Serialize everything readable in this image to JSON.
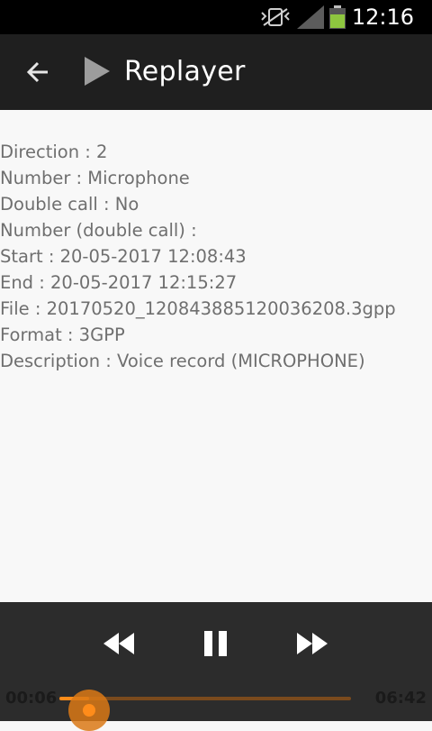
{
  "status_bar": {
    "time": "12:16",
    "icons": [
      "vibrate-icon",
      "signal-icon",
      "battery-icon"
    ],
    "battery_color": "#8ec63f"
  },
  "app_bar": {
    "title": "Replayer",
    "back_icon": "arrow-left-icon",
    "logo_icon": "play-icon"
  },
  "details": [
    "Direction : 2",
    "Number : Microphone",
    "Double call : No",
    "Number (double call) :",
    "Start : 20-05-2017 12:08:43",
    "End : 20-05-2017 12:15:27",
    "File : 20170520_120843885120036208.3gpp",
    "Format : 3GPP",
    "Description : Voice record (MICROPHONE)"
  ],
  "player": {
    "elapsed": "00:06",
    "total": "06:42",
    "progress_fraction": 0.015,
    "controls": [
      "rewind-icon",
      "pause-icon",
      "fast-forward-icon"
    ],
    "accent_color": "#ff8c1a"
  }
}
